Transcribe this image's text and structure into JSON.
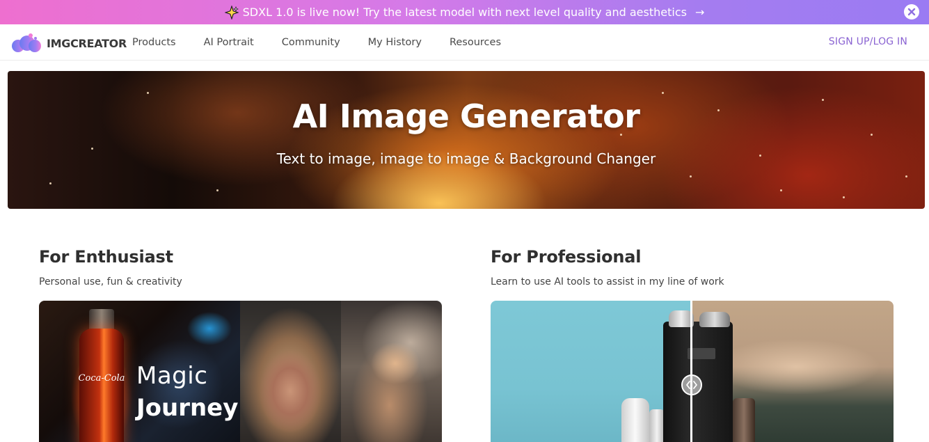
{
  "banner": {
    "text": "SDXL 1.0 is live now! Try the latest model with next level quality and aesthetics",
    "arrow": "→",
    "icon": "sparkle-icon",
    "close_icon": "close-icon"
  },
  "header": {
    "logo_text": "IMGCREATOR",
    "nav": [
      "Products",
      "AI Portrait",
      "Community",
      "My History",
      "Resources"
    ],
    "login": "SIGN UP/LOG IN"
  },
  "hero": {
    "title": "AI Image Generator",
    "subtitle": "Text to image, image to image & Background Changer"
  },
  "sections": [
    {
      "title": "For Enthusiast",
      "subtitle": "Personal use, fun & creativity",
      "card": {
        "overlay_line1": "Magic",
        "overlay_line2": "Journey",
        "bottle_label": "Coca-Cola"
      }
    },
    {
      "title": "For Professional",
      "subtitle": "Learn to use AI tools to assist in my line of work",
      "card": {
        "handle_icon": "compare-slider-icon"
      }
    }
  ],
  "colors": {
    "banner_gradient_start": "#ee6fcf",
    "banner_gradient_end": "#9a7bf3",
    "login_accent": "#8a63d2",
    "heading": "#2f2f2f"
  }
}
